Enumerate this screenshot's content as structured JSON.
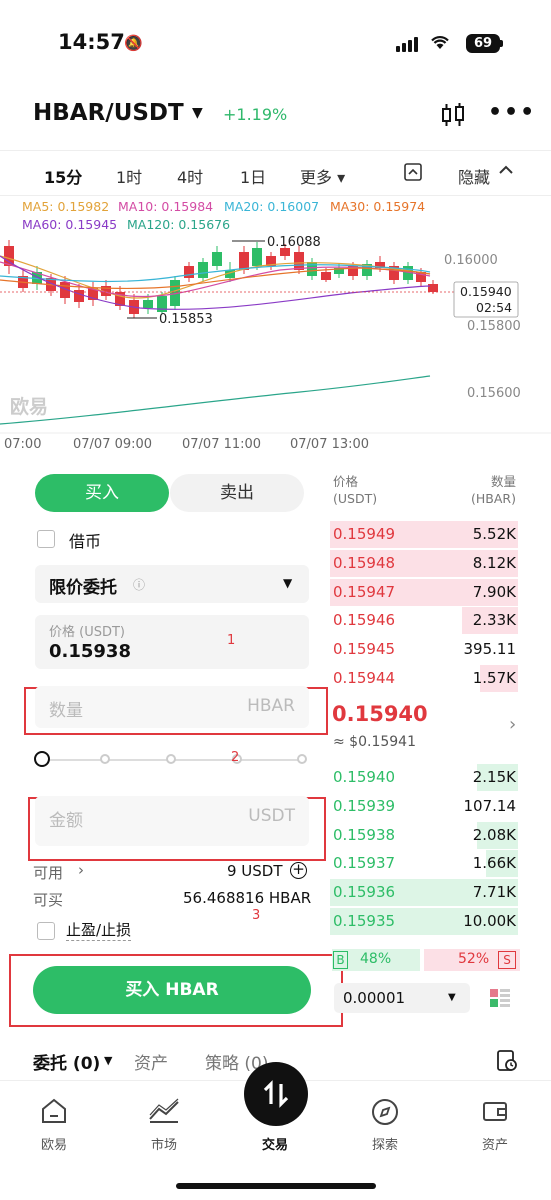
{
  "status": {
    "time": "14:57",
    "battery": "69"
  },
  "header": {
    "pair": "HBAR/USDT",
    "change": "+1.19%"
  },
  "timeframes": [
    "15分",
    "1时",
    "4时",
    "1日",
    "更多 ▾",
    "隐藏"
  ],
  "ma_legend": {
    "ma5": "MA5: 0.15982",
    "ma10": "MA10: 0.15984",
    "ma20": "MA20: 0.16007",
    "ma30": "MA30: 0.15974",
    "ma60": "MA60: 0.15945",
    "ma120": "MA120: 0.15676"
  },
  "chart_labels": {
    "high_marker": "0.16088",
    "low_marker": "0.15853",
    "y_ticks": [
      "0.16000",
      "0.15800",
      "0.15600"
    ],
    "current_price": "0.15940",
    "countdown": "02:54",
    "x_ticks": [
      "07:00",
      "07/07 09:00",
      "07/07 11:00",
      "07/07 13:00"
    ],
    "watermark": "欧易"
  },
  "chart_data": {
    "type": "candlestick",
    "x_ticks": [
      "07:00",
      "07/07 09:00",
      "07/07 11:00",
      "07/07 13:00"
    ],
    "y_ticks": [
      0.16,
      0.158,
      0.156
    ],
    "high": 0.16088,
    "low": 0.15853,
    "last": 0.1594,
    "moving_averages": {
      "MA5": 0.15982,
      "MA10": 0.15984,
      "MA20": 0.16007,
      "MA30": 0.15974,
      "MA60": 0.15945,
      "MA120": 0.15676
    }
  },
  "trade": {
    "buy_tab": "买入",
    "sell_tab": "卖出",
    "margin_label": "借币",
    "order_type": "限价委托",
    "price_label": "价格 (USDT)",
    "price_value": "0.15938",
    "qty_placeholder": "数量",
    "qty_unit": "HBAR",
    "amount_placeholder": "金额",
    "amount_unit": "USDT",
    "available_label": "可用",
    "available_value": "9 USDT",
    "canbuy_label": "可买",
    "canbuy_value": "56.468816 HBAR",
    "tpsl_label": "止盈/止损",
    "submit": "买入 HBAR",
    "annot1": "1",
    "annot2": "2",
    "annot3": "3"
  },
  "orderbook": {
    "price_header": "价格\n(USDT)",
    "qty_header": "数量\n(HBAR)",
    "price_header_1": "价格",
    "price_header_2": "(USDT)",
    "qty_header_1": "数量",
    "qty_header_2": "(HBAR)",
    "asks": [
      {
        "p": "0.15949",
        "q": "5.52K",
        "depth": 1.0
      },
      {
        "p": "0.15948",
        "q": "8.12K",
        "depth": 1.0
      },
      {
        "p": "0.15947",
        "q": "7.90K",
        "depth": 1.0
      },
      {
        "p": "0.15946",
        "q": "2.33K",
        "depth": 0.3
      },
      {
        "p": "0.15945",
        "q": "395.11",
        "depth": 0.0
      },
      {
        "p": "0.15944",
        "q": "1.57K",
        "depth": 0.2
      }
    ],
    "mid_price": "0.15940",
    "mid_usd": "≈ $0.15941",
    "bids": [
      {
        "p": "0.15940",
        "q": "2.15K",
        "depth": 0.22
      },
      {
        "p": "0.15939",
        "q": "107.14",
        "depth": 0.0
      },
      {
        "p": "0.15938",
        "q": "2.08K",
        "depth": 0.22
      },
      {
        "p": "0.15937",
        "q": "1.66K",
        "depth": 0.17
      },
      {
        "p": "0.15936",
        "q": "7.71K",
        "depth": 1.0
      },
      {
        "p": "0.15935",
        "q": "10.00K",
        "depth": 1.0
      }
    ],
    "buy_pct": "48%",
    "sell_pct": "52%",
    "buy_tag": "B",
    "sell_tag": "S",
    "precision": "0.00001"
  },
  "bottom_section": {
    "orders": "委托 (0)",
    "assets": "资产",
    "strategy": "策略 (0)"
  },
  "nav": [
    "欧易",
    "市场",
    "交易",
    "探索",
    "资产"
  ],
  "colors": {
    "green": "#2dbd67",
    "red": "#e0383e",
    "pink": "#fce0e6",
    "lightgreen": "#ddf5e6"
  }
}
